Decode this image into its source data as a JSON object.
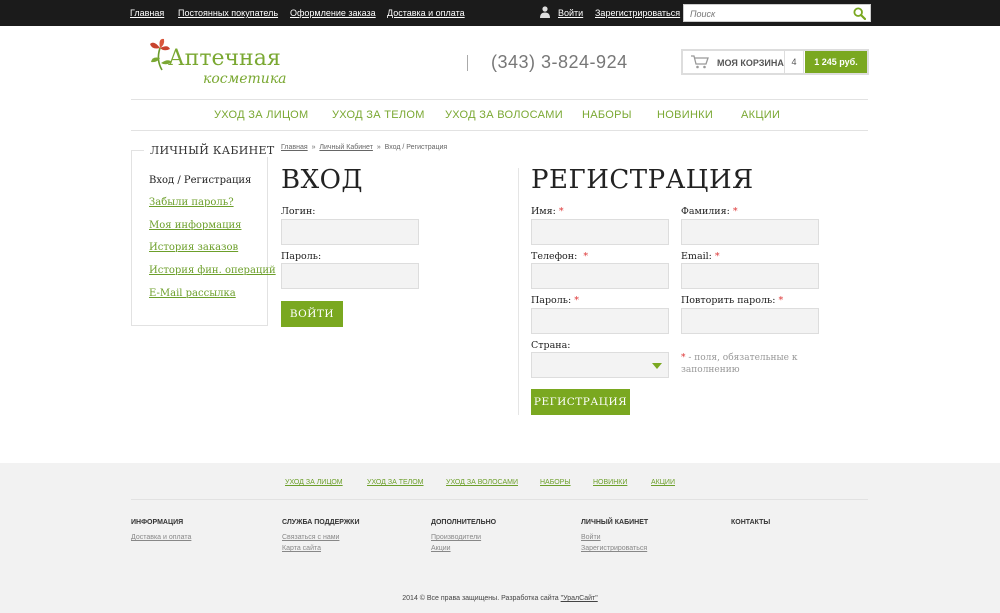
{
  "topbar": {
    "links": [
      "Главная",
      "Постоянных покупатель",
      "Оформление заказа",
      "Доставка и оплата"
    ],
    "login": "Войти",
    "register": "Зарегистрироваться",
    "search_placeholder": "Поиск"
  },
  "header": {
    "logo_line1": "Аптечная",
    "logo_line2": "косметика",
    "phone": "(343) 3-824-924",
    "cart": {
      "label": "МОЯ КОРЗИНА",
      "count": "4",
      "total": "1 245 руб."
    }
  },
  "nav": [
    "УХОД ЗА ЛИЦОМ",
    "УХОД ЗА ТЕЛОМ",
    "УХОД ЗА ВОЛОСАМИ",
    "НАБОРЫ",
    "НОВИНКИ",
    "АКЦИИ"
  ],
  "sidebar": {
    "title": "ЛИЧНЫЙ КАБИНЕТ",
    "items": [
      "Вход / Регистрация",
      "Забыли пароль?",
      "Моя информация",
      "История заказов",
      "История фин. операций",
      "E-Mail рассылка"
    ]
  },
  "breadcrumb": {
    "home": "Главная",
    "sep": "»",
    "cabinet": "Личный Кабинет",
    "current": "Вход / Регистрация"
  },
  "login": {
    "title": "ВХОД",
    "login_label": "Логин:",
    "password_label": "Пароль:",
    "button": "ВОЙТИ"
  },
  "registration": {
    "title": "РЕГИСТРАЦИЯ",
    "name": "Имя:",
    "surname": "Фамилия:",
    "phone": "Телефон:",
    "email": "Email:",
    "password": "Пароль:",
    "repeat_password": "Повторить пароль:",
    "country": "Страна:",
    "required_mark": "*",
    "required_note": " - поля, обязательные к заполнению",
    "button": "РЕГИСТРАЦИЯ"
  },
  "footer": {
    "nav": [
      "УХОД ЗА ЛИЦОМ",
      "УХОД ЗА ТЕЛОМ",
      "УХОД ЗА ВОЛОСАМИ",
      "НАБОРЫ",
      "НОВИНКИ",
      "АКЦИИ"
    ],
    "columns": [
      {
        "title": "ИНФОРМАЦИЯ",
        "links": [
          "Доставка и оплата"
        ]
      },
      {
        "title": "СЛУЖБА ПОДДЕРЖКИ",
        "links": [
          "Связаться с нами",
          "Карта сайта"
        ]
      },
      {
        "title": "ДОПОЛНИТЕЛЬНО",
        "links": [
          "Производители",
          "Акции"
        ]
      },
      {
        "title": "ЛИЧНЫЙ КАБИНЕТ",
        "links": [
          "Войти",
          "Зарегистрироваться"
        ]
      },
      {
        "title": "КОНТАКТЫ",
        "links": []
      }
    ],
    "copyright": "2014 © Все права защищены. Разработка сайта ",
    "dev": "\"УралСайт\""
  },
  "colors": {
    "accent": "#7aa820",
    "link": "#6c9f2a",
    "topbar": "#1b1b1b",
    "required": "#dd3333"
  }
}
